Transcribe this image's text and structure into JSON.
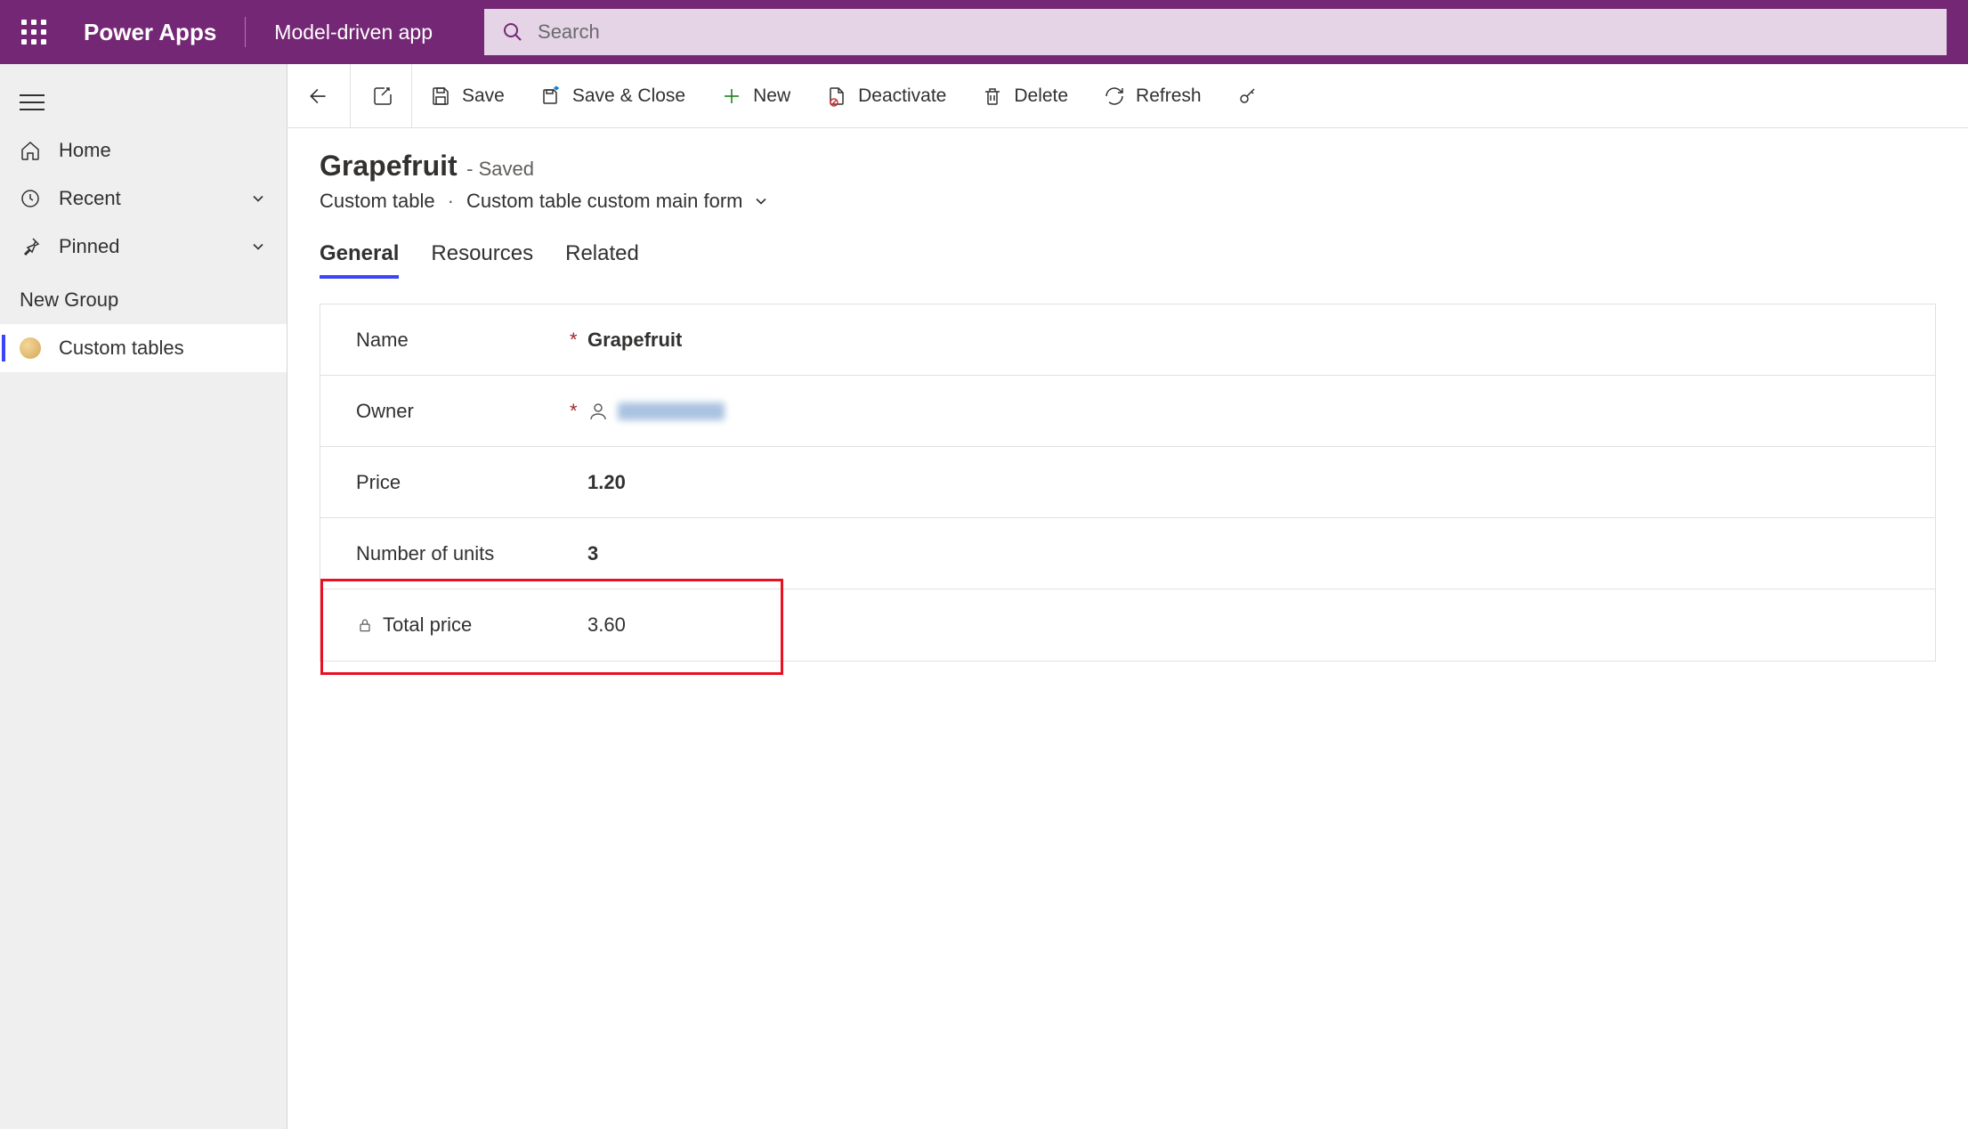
{
  "header": {
    "brand": "Power Apps",
    "appName": "Model-driven app",
    "searchPlaceholder": "Search"
  },
  "sidebar": {
    "home": "Home",
    "recent": "Recent",
    "pinned": "Pinned",
    "groupLabel": "New Group",
    "customTables": "Custom tables"
  },
  "commands": {
    "save": "Save",
    "saveClose": "Save & Close",
    "new": "New",
    "deactivate": "Deactivate",
    "delete": "Delete",
    "refresh": "Refresh"
  },
  "record": {
    "title": "Grapefruit",
    "saveState": "- Saved",
    "entity": "Custom table",
    "formName": "Custom table custom main form"
  },
  "tabs": {
    "general": "General",
    "resources": "Resources",
    "related": "Related"
  },
  "fields": {
    "nameLabel": "Name",
    "nameValue": "Grapefruit",
    "ownerLabel": "Owner",
    "priceLabel": "Price",
    "priceValue": "1.20",
    "unitsLabel": "Number of units",
    "unitsValue": "3",
    "totalLabel": "Total price",
    "totalValue": "3.60"
  }
}
